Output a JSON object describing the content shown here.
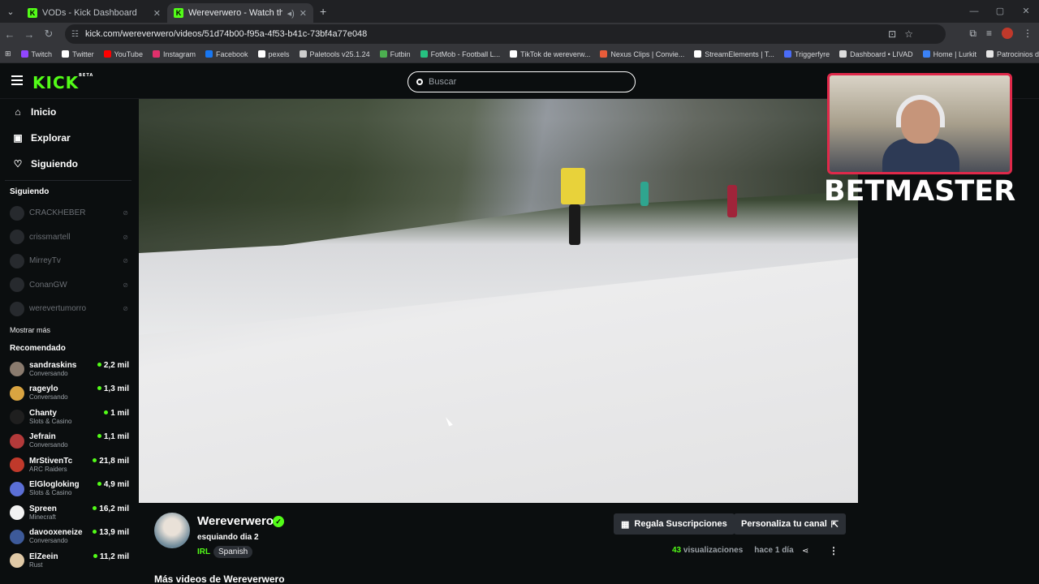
{
  "browser": {
    "tabs": [
      {
        "label": "VODs - Kick Dashboard"
      },
      {
        "label": "Wereverwero - Watch the V"
      }
    ],
    "url": "kick.com/wereverwero/videos/51d74b00-f95a-4f53-b41c-73bf4a77e048",
    "bookmarks": [
      {
        "label": "Twitch",
        "color": "#9146ff"
      },
      {
        "label": "Twitter",
        "color": "#ffffff"
      },
      {
        "label": "YouTube",
        "color": "#ff0000"
      },
      {
        "label": "Instagram",
        "color": "#e1306c"
      },
      {
        "label": "Facebook",
        "color": "#1877f2"
      },
      {
        "label": "pexels",
        "color": "#ffffff"
      },
      {
        "label": "Paletools v25.1.24",
        "color": "#cccccc"
      },
      {
        "label": "Futbin",
        "color": "#4caf50"
      },
      {
        "label": "FotMob - Football L...",
        "color": "#26c281"
      },
      {
        "label": "TikTok de wereverw...",
        "color": "#ffffff"
      },
      {
        "label": "Nexus Clips | Convie...",
        "color": "#e85c3a"
      },
      {
        "label": "StreamElements | T...",
        "color": "#ffffff"
      },
      {
        "label": "Triggerfyre",
        "color": "#4a6cf7"
      },
      {
        "label": "Dashboard • LIVAD",
        "color": "#dddddd"
      },
      {
        "label": "Home | Lurkit",
        "color": "#3b82f6"
      },
      {
        "label": "Patrocinios disponib...",
        "color": "#e5e5e5"
      }
    ]
  },
  "header": {
    "logo": "KICK",
    "logo_badge": "BETA",
    "search_placeholder": "Buscar"
  },
  "sidebar": {
    "nav": [
      {
        "label": "Inicio",
        "icon": "home-icon",
        "glyph": "⌂"
      },
      {
        "label": "Explorar",
        "icon": "compass-icon",
        "glyph": "▣"
      },
      {
        "label": "Siguiendo",
        "icon": "heart-icon",
        "glyph": "♡"
      }
    ],
    "following_title": "Siguiendo",
    "following": [
      {
        "name": "CRACKHEBER"
      },
      {
        "name": "crissmartell"
      },
      {
        "name": "MirreyTv"
      },
      {
        "name": "ConanGW"
      },
      {
        "name": "werevertumorro"
      }
    ],
    "show_more": "Mostrar más",
    "recommended_title": "Recomendado",
    "recommended": [
      {
        "name": "sandraskins",
        "category": "Conversando",
        "viewers": "2,2 mil",
        "color": "#8a7b6e"
      },
      {
        "name": "rageylo",
        "category": "Conversando",
        "viewers": "1,3 mil",
        "color": "#d9a441"
      },
      {
        "name": "Chanty",
        "category": "Slots & Casino",
        "viewers": "1 mil",
        "color": "#1f1f1f"
      },
      {
        "name": "Jefrain",
        "category": "Conversando",
        "viewers": "1,1 mil",
        "color": "#b33a3a"
      },
      {
        "name": "MrStivenTc",
        "category": "ARC Raiders",
        "viewers": "21,8 mil",
        "color": "#c0392b"
      },
      {
        "name": "ElGlogloking",
        "category": "Slots & Casino",
        "viewers": "4,9 mil",
        "color": "#5b6fd6"
      },
      {
        "name": "Spreen",
        "category": "Minecraft",
        "viewers": "16,2 mil",
        "color": "#f2f2f2"
      },
      {
        "name": "davooxeneize",
        "category": "Conversando",
        "viewers": "13,9 mil",
        "color": "#3d5a99"
      },
      {
        "name": "ElZeein",
        "category": "Rust",
        "viewers": "11,2 mil",
        "color": "#e0c9a6"
      }
    ]
  },
  "overlay": {
    "sponsor": "BETMASTER"
  },
  "channel": {
    "name": "Wereverwero",
    "video_title": "esquiando dia 2",
    "category": "IRL",
    "language": "Spanish",
    "gift_button": "Regala Suscripciones",
    "customize_button": "Personaliza tu canal",
    "views_count": "43",
    "views_label": "visualizaciones",
    "time_ago": "hace 1 día",
    "more_videos": "Más videos de Wereverwero"
  }
}
